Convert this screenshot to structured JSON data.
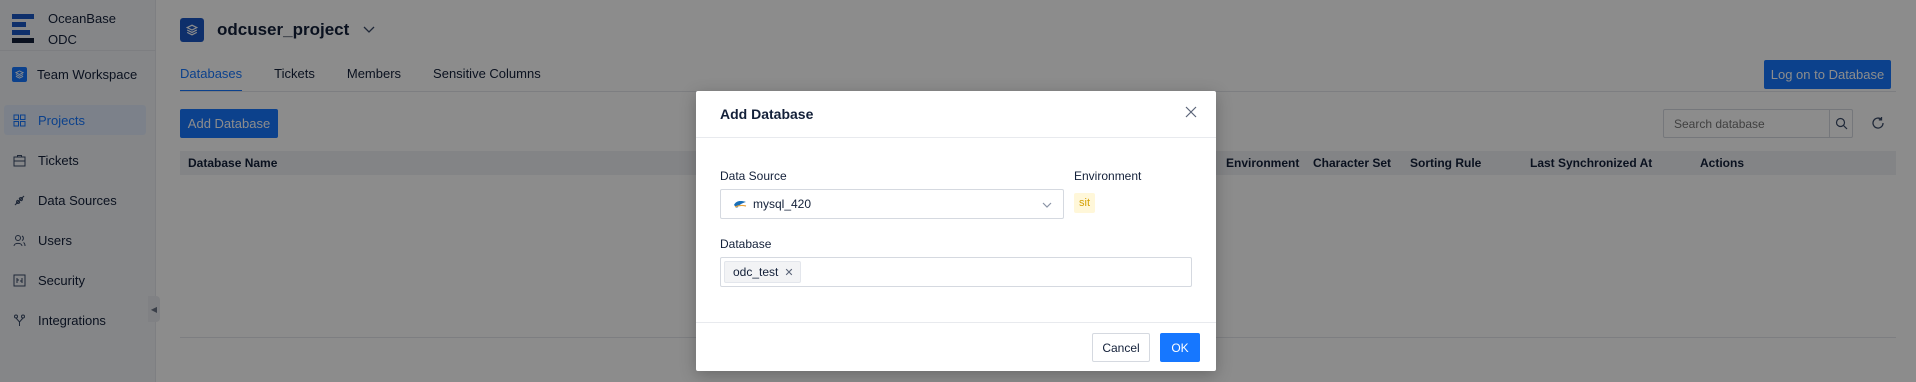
{
  "app": {
    "brand_line1": "OceanBase",
    "brand_line2": "ODC"
  },
  "sidebar": {
    "workspace": "Team Workspace",
    "items": [
      {
        "label": "Projects",
        "icon": "projects-icon",
        "active": true
      },
      {
        "label": "Tickets",
        "icon": "tickets-icon"
      },
      {
        "label": "Data Sources",
        "icon": "data-sources-icon"
      },
      {
        "label": "Users",
        "icon": "users-icon"
      },
      {
        "label": "Security",
        "icon": "security-icon"
      },
      {
        "label": "Integrations",
        "icon": "integrations-icon"
      }
    ]
  },
  "project": {
    "title": "odcuser_project",
    "tabs": [
      {
        "label": "Databases",
        "active": true
      },
      {
        "label": "Tickets"
      },
      {
        "label": "Members"
      },
      {
        "label": "Sensitive Columns"
      }
    ],
    "logon_button": "Log on to Database",
    "add_button": "Add Database",
    "search_placeholder": "Search database",
    "table_headers": {
      "name": "Database Name",
      "environment": "Environment",
      "charset": "Character Set",
      "sorting": "Sorting Rule",
      "synced": "Last Synchronized At",
      "actions": "Actions"
    }
  },
  "modal": {
    "title": "Add Database",
    "data_source_label": "Data Source",
    "data_source_value": "mysql_420",
    "environment_label": "Environment",
    "environment_value": "sit",
    "database_label": "Database",
    "selected_databases": [
      "odc_test"
    ],
    "cancel": "Cancel",
    "ok": "OK"
  },
  "colors": {
    "primary": "#1677ff",
    "brand": "#1a56c4",
    "env_tag_bg": "#fff7d9",
    "env_tag_text": "#d4a106"
  }
}
